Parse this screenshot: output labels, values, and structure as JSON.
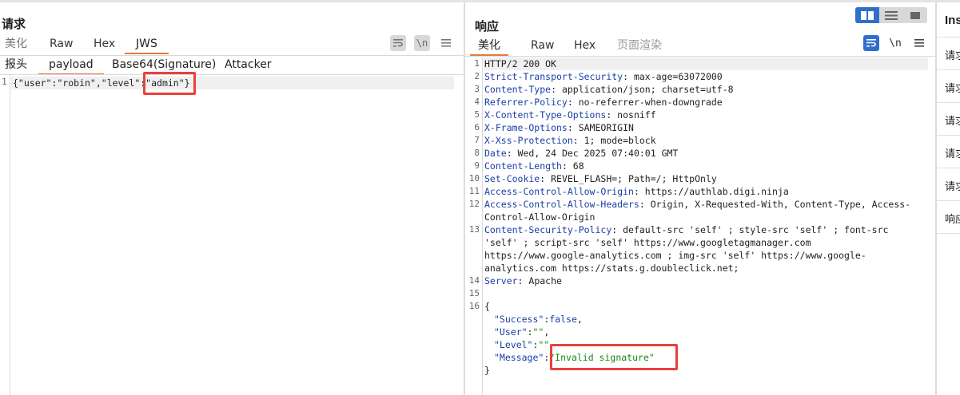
{
  "request": {
    "title": "请求",
    "tabs": [
      "美化",
      "Raw",
      "Hex",
      "JWS"
    ],
    "active_tab": "JWS",
    "subtabs": [
      "报头",
      "payload",
      "Base64(Signature)",
      "Attacker"
    ],
    "active_subtab": "payload",
    "icons": [
      "wrap-icon",
      "newline-icon",
      "menu-icon"
    ],
    "newline_label": "\\n",
    "line_number": "1",
    "code": {
      "p1": "{\"user\":\"robin\",\"level\":",
      "p2": "\"admin\"}"
    }
  },
  "response": {
    "title": "响应",
    "tabs": [
      "美化",
      "Raw",
      "Hex",
      "页面渲染"
    ],
    "active_tab": "美化",
    "newline_label": "\\n",
    "headers": [
      {
        "n": "1",
        "text": "HTTP/2 200 OK"
      },
      {
        "n": "2",
        "key": "Strict-Transport-Security",
        "val": ": max-age=63072000"
      },
      {
        "n": "3",
        "key": "Content-Type",
        "val": ": application/json; charset=utf-8"
      },
      {
        "n": "4",
        "key": "Referrer-Policy",
        "val": ": no-referrer-when-downgrade"
      },
      {
        "n": "5",
        "key": "X-Content-Type-Options",
        "val": ": nosniff"
      },
      {
        "n": "6",
        "key": "X-Frame-Options",
        "val": ": SAMEORIGIN"
      },
      {
        "n": "7",
        "key": "X-Xss-Protection",
        "val": ": 1; mode=block"
      },
      {
        "n": "8",
        "key": "Date",
        "val": ": Wed, 24 Dec 2025 07:40:01 GMT"
      },
      {
        "n": "9",
        "key": "Content-Length",
        "val": ": 68"
      },
      {
        "n": "10",
        "key": "Set-Cookie",
        "val": ": REVEL_FLASH=; Path=/; HttpOnly"
      },
      {
        "n": "11",
        "key": "Access-Control-Allow-Origin",
        "val": ": https://authlab.digi.ninja"
      },
      {
        "n": "12",
        "key": "Access-Control-Allow-Headers",
        "val": ": Origin, X-Requested-With, Content-Type, Access-Control-Allow-Origin"
      },
      {
        "n": "13",
        "key": "Content-Security-Policy",
        "val": ": default-src 'self' ; style-src 'self' ; font-src 'self' ; script-src 'self' https://www.googletagmanager.com https://www.google-analytics.com ; img-src 'self' https://www.google-analytics.com https://stats.g.doubleclick.net;"
      },
      {
        "n": "14",
        "key": "Server",
        "val": ": Apache"
      },
      {
        "n": "15",
        "text": ""
      }
    ],
    "body_line_number": "16",
    "body": {
      "open": "{",
      "success_key": "\"Success\"",
      "success_val": "false",
      "user_key": "\"User\"",
      "user_val": "\"\"",
      "level_key": "\"Level\"",
      "level_val": "\"\"",
      "message_key": "\"Message\"",
      "message_val": "\"Invalid signature\"",
      "close": "}"
    }
  },
  "inspector": {
    "title": "Inspector",
    "rows": [
      "请求属性",
      "请求查询参数",
      "请求正文参数",
      "请求cookie",
      "请求标头",
      "响应标头"
    ]
  },
  "colors": {
    "accent_tab": "#e8783a",
    "highlight": "#e8413d",
    "toggle_active": "#2f6fcb",
    "header_key": "#1a3fa5",
    "json_string": "#148a18"
  }
}
